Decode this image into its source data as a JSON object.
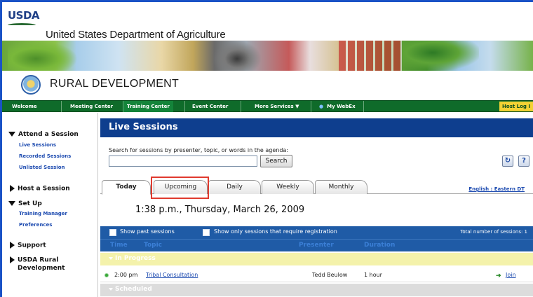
{
  "header": {
    "logo_text": "USDA",
    "agency": "United States Department of Agriculture"
  },
  "rd": {
    "title": "RURAL DEVELOPMENT"
  },
  "nav": {
    "items": [
      "Welcome",
      "Meeting Center",
      "Training Center",
      "Event Center",
      "More Services ▼",
      "My WebEx"
    ],
    "host_log": "Host Log I"
  },
  "sidebar": {
    "attend": "Attend a Session",
    "live": "Live Sessions",
    "recorded": "Recorded Sessions",
    "unlisted": "Unlisted Session",
    "host": "Host a Session",
    "setup": "Set Up",
    "training_manager": "Training Manager",
    "preferences": "Preferences",
    "support": "Support",
    "usda1": "USDA Rural",
    "usda2": "Development"
  },
  "main": {
    "title": "Live Sessions",
    "search_label": "Search for sessions by presenter, topic, or words in the agenda:",
    "search_value": "",
    "search_button": "Search",
    "refresh_icon": "refresh-icon",
    "help_label": "?",
    "tabs": [
      "Today",
      "Upcoming",
      "Daily",
      "Weekly",
      "Monthly"
    ],
    "active_tab": "Today",
    "lang": "English : Eastern DT",
    "datetime": "1:38 p.m., Thursday, March 26, 2009",
    "show_past": "Show past sessions",
    "show_reg": "Show only sessions that require registration",
    "total": "Total number of sessions: 1",
    "col_time": "Time",
    "col_topic": "Topic",
    "col_presenter": "Presenter",
    "col_duration": "Duration",
    "in_progress": "In Progress",
    "scheduled": "Scheduled",
    "session": {
      "time": "2:00 pm",
      "topic": "Tribal Consultation",
      "presenter": "Tedd Beulow",
      "duration": "1 hour",
      "action": "Join"
    }
  },
  "colors": {
    "nav_green": "#0f6b2a",
    "title_blue": "#0e3e8e",
    "bar_blue": "#1f5ba6",
    "link_blue": "#1d4bb0",
    "highlight_red": "#e03a2e",
    "inprogress_yellow": "#f4f2ab"
  }
}
